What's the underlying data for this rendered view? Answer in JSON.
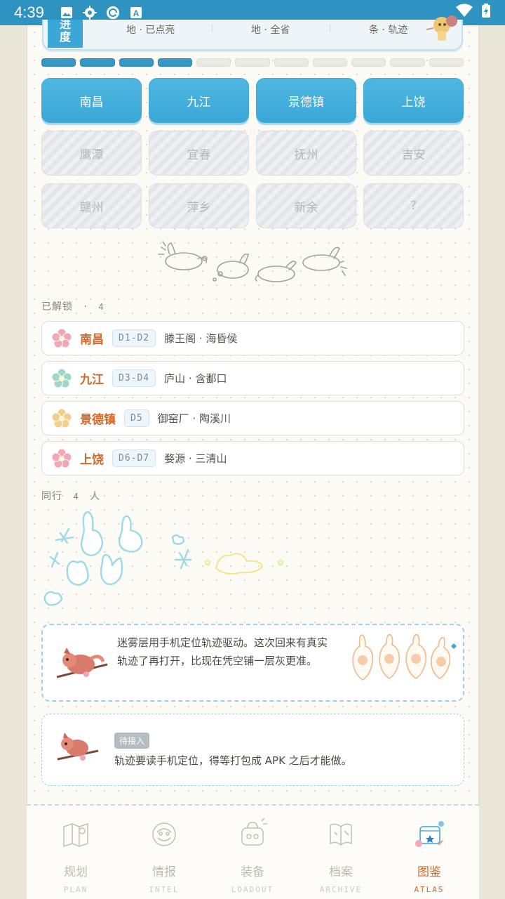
{
  "status_bar": {
    "time": "4:39"
  },
  "progress": {
    "tag_top": "进",
    "tag_bottom": "度",
    "cells": [
      "地 · 已点亮",
      "地 · 全省",
      "条 · 轨迹"
    ],
    "segments_total": 11,
    "segments_on": 4
  },
  "cities": [
    {
      "name": "南昌",
      "unlocked": true
    },
    {
      "name": "九江",
      "unlocked": true
    },
    {
      "name": "景德镇",
      "unlocked": true
    },
    {
      "name": "上饶",
      "unlocked": true
    },
    {
      "name": "鹰潭",
      "unlocked": false
    },
    {
      "name": "宜春",
      "unlocked": false
    },
    {
      "name": "抚州",
      "unlocked": false
    },
    {
      "name": "吉安",
      "unlocked": false
    },
    {
      "name": "赣州",
      "unlocked": false
    },
    {
      "name": "萍乡",
      "unlocked": false
    },
    {
      "name": "新余",
      "unlocked": false
    },
    {
      "name": "?",
      "unlocked": false
    }
  ],
  "unlocked_section": {
    "label": "已解锁",
    "sep": "·",
    "count": "4"
  },
  "unlocked_list": [
    {
      "name": "南昌",
      "days": "D1-D2",
      "sights": "滕王阁 · 海昏侯",
      "flower": "#f3a6b6"
    },
    {
      "name": "九江",
      "days": "D3-D4",
      "sights": "庐山 · 含鄱口",
      "flower": "#9fd8c8"
    },
    {
      "name": "景德镇",
      "days": "D5",
      "sights": "御窑厂 · 陶溪川",
      "flower": "#f2cf8a"
    },
    {
      "name": "上饶",
      "days": "D6-D7",
      "sights": "婺源 · 三清山",
      "flower": "#f3a6b6"
    }
  ],
  "companions_section": {
    "label": "同行",
    "count": "4",
    "unit": "人"
  },
  "notes": [
    {
      "text": "迷雾层用手机定位轨迹驱动。这次回来有真实轨迹了再打开，比现在凭空铺一层灰更准。"
    },
    {
      "badge": "待接入",
      "text": "轨迹要读手机定位，得等打包成 APK 之后才能做。"
    }
  ],
  "nav": [
    {
      "zh": "规划",
      "en": "PLAN",
      "icon": "map-icon"
    },
    {
      "zh": "情报",
      "en": "INTEL",
      "icon": "news-icon"
    },
    {
      "zh": "装备",
      "en": "LOADOUT",
      "icon": "bag-icon"
    },
    {
      "zh": "档案",
      "en": "ARCHIVE",
      "icon": "book-icon"
    },
    {
      "zh": "图鉴",
      "en": "ATLAS",
      "icon": "atlas-icon",
      "active": true
    }
  ]
}
